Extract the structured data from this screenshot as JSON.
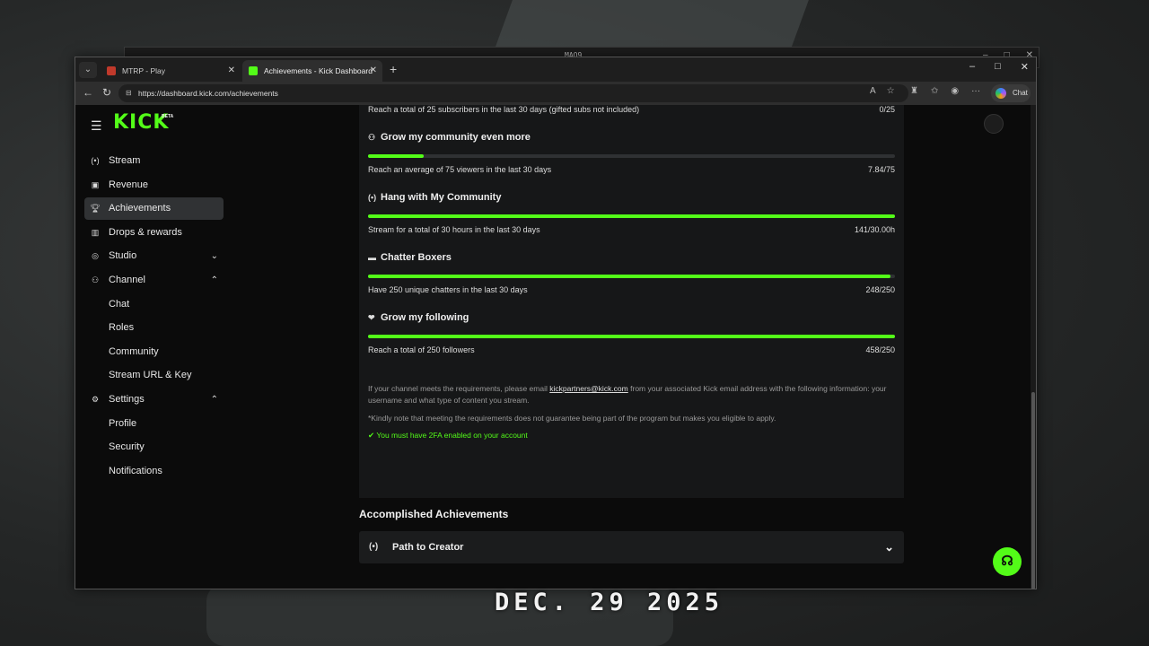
{
  "backdrop": {
    "back_window_title": "MAQ9",
    "date_stamp": "DEC. 29 2025"
  },
  "browser": {
    "tabs": [
      {
        "label": "MTRP - Play"
      },
      {
        "label": "Achievements - Kick Dashboard"
      }
    ],
    "url": "https://dashboard.kick.com/achievements",
    "copilot_label": "Chat"
  },
  "header": {
    "logo": "KICK",
    "logo_badge": "BETA"
  },
  "sidebar": {
    "items": [
      {
        "label": "Stream",
        "icon": "broadcast-icon"
      },
      {
        "label": "Revenue",
        "icon": "revenue-icon"
      },
      {
        "label": "Achievements",
        "icon": "trophy-icon",
        "active": true
      },
      {
        "label": "Drops & rewards",
        "icon": "drops-icon"
      },
      {
        "label": "Studio",
        "icon": "studio-icon",
        "expandable": true
      },
      {
        "label": "Channel",
        "icon": "channel-icon",
        "expanded": true
      },
      {
        "label": "Chat"
      },
      {
        "label": "Roles"
      },
      {
        "label": "Community"
      },
      {
        "label": "Stream URL & Key"
      },
      {
        "label": "Settings",
        "icon": "gear-icon",
        "expanded": true
      },
      {
        "label": "Profile"
      },
      {
        "label": "Security"
      },
      {
        "label": "Notifications"
      }
    ]
  },
  "achievements": {
    "top_partial": {
      "description": "Reach a total of 25 subscribers in the last 30 days (gifted subs not included)",
      "value": "0/25"
    },
    "rows": [
      {
        "title": "Grow my community even more",
        "icon": "people-icon",
        "description": "Reach an average of 75 viewers in the last 30 days",
        "value": "7.84/75",
        "progress": 0.105
      },
      {
        "title": "Hang with My Community",
        "icon": "broadcast-icon",
        "description": "Stream for a total of 30 hours in the last 30 days",
        "value": "141/30.00h",
        "progress": 1.0
      },
      {
        "title": "Chatter Boxers",
        "icon": "chat-bubble-icon",
        "description": "Have 250 unique chatters in the last 30 days",
        "value": "248/250",
        "progress": 0.992
      },
      {
        "title": "Grow my following",
        "icon": "heart-icon",
        "description": "Reach a total of 250 followers",
        "value": "458/250",
        "progress": 1.0
      }
    ],
    "info_text_1": "If your channel meets the requirements, please email",
    "info_email": "kickpartners@kick.com",
    "info_text_2": "from your associated Kick email address with the following information: your username and what type of content you stream.",
    "info_note": "*Kindly note that meeting the requirements does not guarantee being part of the program but makes you eligible to apply.",
    "twofa": "You must have 2FA enabled on your account"
  },
  "accomplished": {
    "title": "Accomplished Achievements",
    "items": [
      {
        "label": "Path to Creator"
      }
    ]
  },
  "colors": {
    "accent": "#53fc18",
    "page_bg": "#0b0b0b",
    "card_bg": "#161718"
  }
}
